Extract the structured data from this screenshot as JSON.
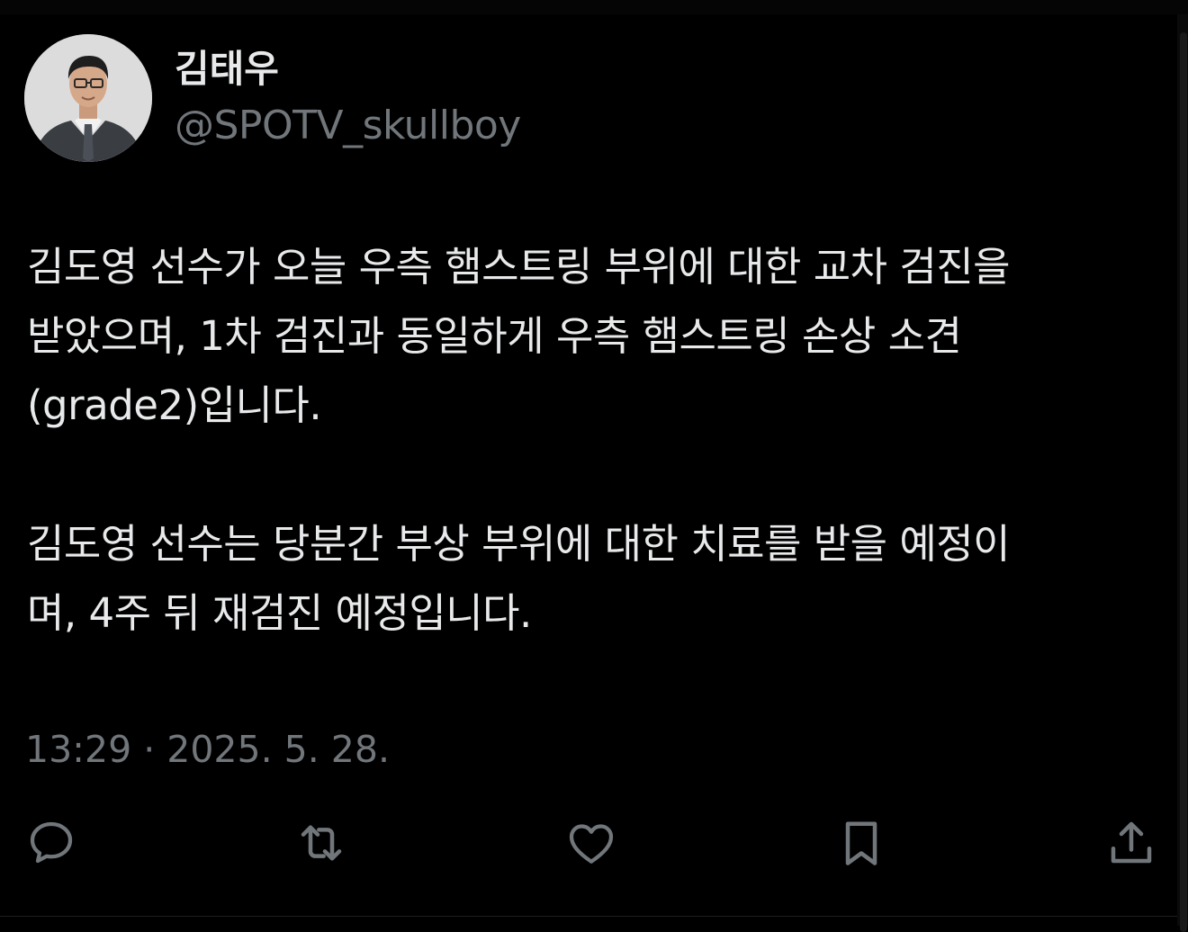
{
  "author": {
    "display_name": "김태우",
    "handle": "@SPOTV_skullboy"
  },
  "tweet": {
    "paragraph1": {
      "line1": "김도영 선수가 오늘 우측 햄스트링 부위에 대한 교차 검진을",
      "line2": "받았으며, 1차 검진과 동일하게 우측 햄스트링 손상 소견",
      "line3": "(grade2)입니다."
    },
    "paragraph2": {
      "line1": "김도영 선수는 당분간 부상 부위에 대한 치료를 받을 예정이",
      "line2": "며, 4주 뒤 재검진 예정입니다."
    },
    "timestamp": "13:29 · 2025. 5. 28."
  },
  "actions": {
    "reply_icon": "reply-icon",
    "retweet_icon": "retweet-icon",
    "like_icon": "heart-icon",
    "bookmark_icon": "bookmark-icon",
    "share_icon": "share-icon"
  },
  "colors": {
    "background": "#000000",
    "text_primary": "#e7e9ea",
    "text_secondary": "#71767b"
  }
}
